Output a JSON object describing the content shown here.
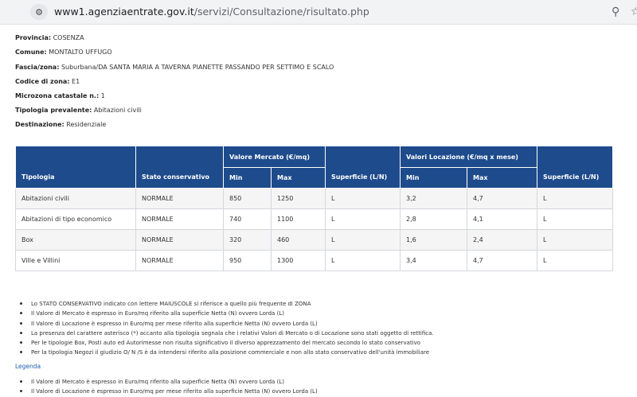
{
  "browser": {
    "url_host": "www1.agenziaentrate.gov.it",
    "url_path": "/servizi/Consultazione/risultato.php"
  },
  "info": [
    {
      "label": "Provincia:",
      "value": "COSENZA"
    },
    {
      "label": "Comune:",
      "value": "MONTALTO UFFUGO"
    },
    {
      "label": "Fascia/zona:",
      "value": "Suburbana/DA SANTA MARIA A TAVERNA PIANETTE PASSANDO PER SETTIMO E SCALO"
    },
    {
      "label": "Codice di zona:",
      "value": "E1"
    },
    {
      "label": "Microzona catastale n.:",
      "value": "1"
    },
    {
      "label": "Tipologia prevalente:",
      "value": "Abitazioni civili"
    },
    {
      "label": "Destinazione:",
      "value": "Residenziale"
    }
  ],
  "table": {
    "headers": {
      "tipologia": "Tipologia",
      "stato": "Stato conservativo",
      "valore_mercato": "Valore Mercato (€/mq)",
      "min": "Min",
      "max": "Max",
      "superficie": "Superficie (L/N)",
      "valori_locazione": "Valori Locazione (€/mq x mese)",
      "loc_min": "Min",
      "loc_max": "Max",
      "loc_superficie": "Superficie (L/N)"
    },
    "rows": [
      {
        "tipologia": "Abitazioni civili",
        "stato": "NORMALE",
        "min": "850",
        "max": "1250",
        "sup": "L",
        "loc_min": "3,2",
        "loc_max": "4,7",
        "loc_sup": "L"
      },
      {
        "tipologia": "Abitazioni di tipo economico",
        "stato": "NORMALE",
        "min": "740",
        "max": "1100",
        "sup": "L",
        "loc_min": "2,8",
        "loc_max": "4,1",
        "loc_sup": "L"
      },
      {
        "tipologia": "Box",
        "stato": "NORMALE",
        "min": "320",
        "max": "460",
        "sup": "L",
        "loc_min": "1,6",
        "loc_max": "2,4",
        "loc_sup": "L"
      },
      {
        "tipologia": "Ville e Villini",
        "stato": "NORMALE",
        "min": "950",
        "max": "1300",
        "sup": "L",
        "loc_min": "3,4",
        "loc_max": "4,7",
        "loc_sup": "L"
      }
    ]
  },
  "notes": [
    "Lo STATO CONSERVATIVO indicato con lettere MAIUSCOLE si riferisce a quello più frequente di ZONA",
    "Il Valore di Mercato è espresso in Euro/mq riferito alla superficie Netta (N) ovvero Lorda (L)",
    "Il Valore di Locazione è espresso in Euro/mq per mese riferito alla superficie Netta (N) ovvero Lorda (L)",
    "La presenza del carattere asterisco (*) accanto alla tipologia segnala che i relativi Valori di Mercato o di Locazione sono stati oggetto di rettifica.",
    "Per le tipologie Box, Posti auto ed Autorimesse non risulta significativo il diverso apprezzamento del mercato secondo lo stato conservativo",
    "Per la tipologia Negozi il giudizio O/ N /S è da intendersi riferito alla posizione commerciale e non allo stato conservativo dell'unità immobiliare"
  ],
  "legenda_label": "Legenda",
  "legend_notes": [
    "Il Valore di Mercato è espresso in Euro/mq riferito alla superficie Netta (N) ovvero Lorda (L)",
    "Il Valore di Locazione è espresso in Euro/mq per mese riferito alla superficie Netta (N) ovvero Lorda (L)"
  ]
}
